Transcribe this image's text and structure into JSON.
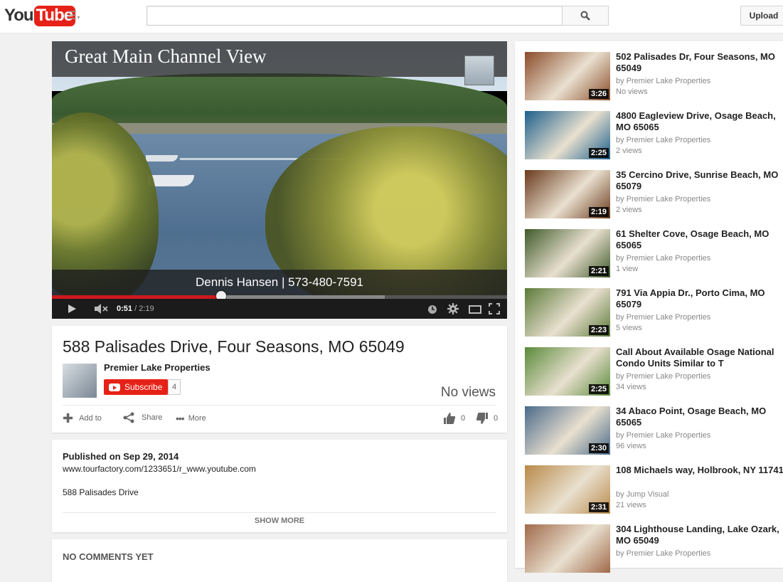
{
  "header": {
    "logo_you": "You",
    "logo_tube": "Tube",
    "search_placeholder": "",
    "upload_label": "Upload"
  },
  "player": {
    "overlay_title": "Great Main Channel View",
    "caption": "Dennis Hansen | 573-480-7591",
    "current_time": "0:51",
    "duration": "/ 2:19",
    "progress_percent": 37
  },
  "video": {
    "title": "588 Palisades Drive, Four Seasons, MO 65049",
    "owner": "Premier Lake Properties",
    "subscribe_label": "Subscribe",
    "subscriber_count": "4",
    "views": "No views",
    "actions": {
      "add_to": "Add to",
      "share": "Share",
      "more": "More"
    },
    "likes": "0",
    "dislikes": "0"
  },
  "description": {
    "published": "Published on Sep 29, 2014",
    "link": "www.tourfactory.com/1233651/r_www.youtube.com",
    "text": "588 Palisades Drive",
    "show_more": "SHOW MORE"
  },
  "comments": {
    "header": "NO COMMENTS YET"
  },
  "related": [
    {
      "title": "502 Palisades Dr, Four Seasons, MO 65049",
      "by": "by Premier Lake Properties",
      "views": "No views",
      "duration": "3:26",
      "thumb_color": "#8a4b2a"
    },
    {
      "title": "4800 Eagleview Drive, Osage Beach, MO 65065",
      "by": "by Premier Lake Properties",
      "views": "2 views",
      "duration": "2:25",
      "thumb_color": "#1c5f8c"
    },
    {
      "title": "35 Cercino Drive, Sunrise Beach, MO 65079",
      "by": "by Premier Lake Properties",
      "views": "2 views",
      "duration": "2:19",
      "thumb_color": "#6a3a1c"
    },
    {
      "title": "61 Shelter Cove, Osage Beach, MO 65065",
      "by": "by Premier Lake Properties",
      "views": "1 view",
      "duration": "2:21",
      "thumb_color": "#3f5a2a"
    },
    {
      "title": "791 Via Appia Dr., Porto Cima, MO 65079",
      "by": "by Premier Lake Properties",
      "views": "5 views",
      "duration": "2:23",
      "thumb_color": "#5c7a3a"
    },
    {
      "title": "Call About Available Osage National Condo Units Similar to T",
      "by": "by Premier Lake Properties",
      "views": "34 views",
      "duration": "2:25",
      "thumb_color": "#5a8a3a"
    },
    {
      "title": "34 Abaco Point, Osage Beach, MO 65065",
      "by": "by Premier Lake Properties",
      "views": "96 views",
      "duration": "2:30",
      "thumb_color": "#4a6a8a"
    },
    {
      "title": "108 Michaels way, Holbrook, NY 11741",
      "by": "by Jump Visual",
      "views": "21 views",
      "duration": "2:31",
      "thumb_color": "#b98a4a"
    },
    {
      "title": "304 Lighthouse Landing, Lake Ozark, MO 65049",
      "by": "by Premier Lake Properties",
      "views": "",
      "duration": "",
      "thumb_color": "#a06a4a"
    }
  ]
}
